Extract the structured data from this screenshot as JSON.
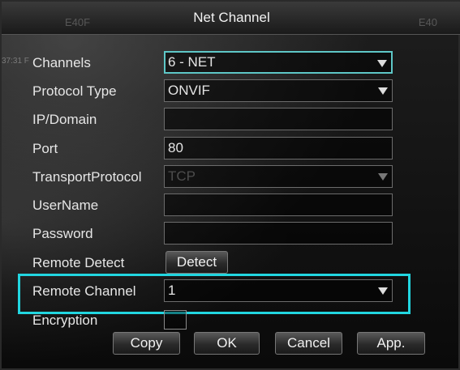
{
  "window": {
    "title": "Net Channel",
    "bg_left_text": "E40F",
    "bg_right_text": "E40",
    "bg_time_text": "37:31 F"
  },
  "form": {
    "channels": {
      "label": "Channels",
      "value": "6 - NET"
    },
    "protocol_type": {
      "label": "Protocol Type",
      "value": "ONVIF"
    },
    "ip_domain": {
      "label": "IP/Domain",
      "value": ""
    },
    "port": {
      "label": "Port",
      "value": "80"
    },
    "transport_protocol": {
      "label": "TransportProtocol",
      "value": "TCP"
    },
    "username": {
      "label": "UserName",
      "value": ""
    },
    "password": {
      "label": "Password",
      "value": ""
    },
    "remote_detect": {
      "label": "Remote Detect",
      "button": "Detect"
    },
    "remote_channel": {
      "label": "Remote Channel",
      "value": "1"
    },
    "encryption": {
      "label": "Encryption"
    }
  },
  "buttons": {
    "copy": "Copy",
    "ok": "OK",
    "cancel": "Cancel",
    "apply": "App."
  },
  "colors": {
    "highlight": "#22d6e0",
    "focus_border": "#5ec7c7"
  }
}
